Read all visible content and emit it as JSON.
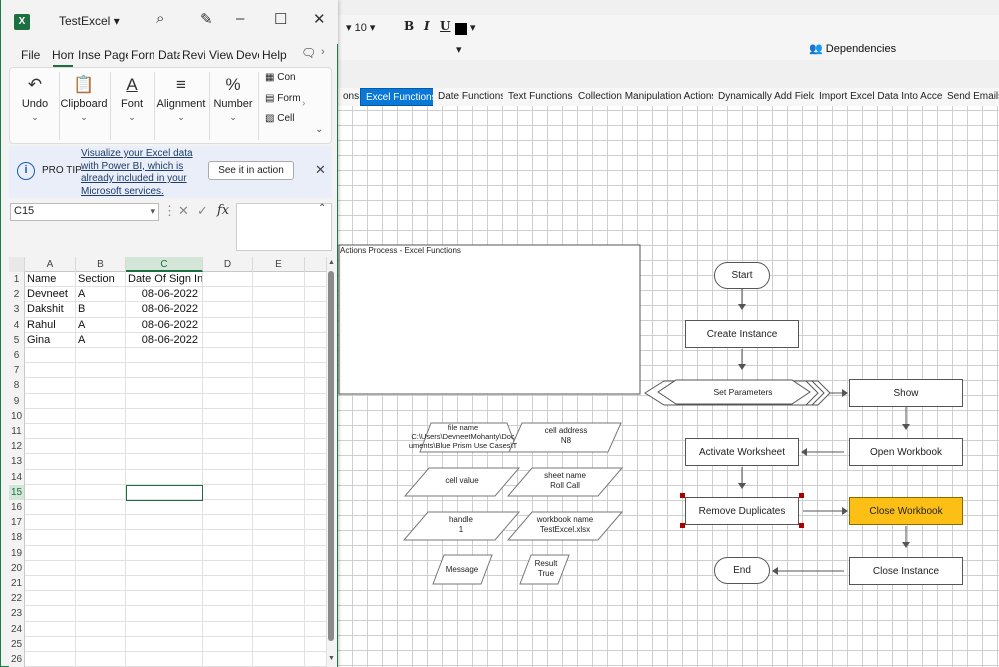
{
  "blueprism": {
    "toolbar": {
      "font_size": "10",
      "bold": "B",
      "italic": "I",
      "underline": "U",
      "dependencies": "Dependencies"
    },
    "tabs": [
      "ons",
      "Excel Functions",
      "Date Functions",
      "Text Functions",
      "Collection Manipulation Actions",
      "Dynamically Add Fields",
      "Import Excel Data Into Access",
      "Send Emails U"
    ],
    "active_tab": "Excel Functions",
    "canvas": {
      "page_title": "Actions Process - Excel Functions",
      "stages": {
        "start": "Start",
        "create_instance": "Create Instance",
        "set_parameters": "Set Parameters",
        "show": "Show",
        "activate_worksheet": "Activate Worksheet",
        "open_workbook": "Open Workbook",
        "remove_duplicates": "Remove Duplicates",
        "close_workbook": "Close Workbook",
        "end": "End",
        "close_instance": "Close Instance"
      },
      "data_items": {
        "file_name": {
          "name": "file name",
          "value1": "C:\\Users\\DevneetMohanty\\Doc",
          "value2": "uments\\Blue Prism Use Cases\\T"
        },
        "cell_address": {
          "name": "cell address",
          "value": "N8"
        },
        "cell_value": {
          "name": "cell value",
          "value": ""
        },
        "sheet_name": {
          "name": "sheet name",
          "value": "Roll Call"
        },
        "handle": {
          "name": "handle",
          "value": "1"
        },
        "workbook_name": {
          "name": "workbook name",
          "value": "TestExcel.xlsx"
        },
        "message": {
          "name": "Message",
          "value": ""
        },
        "result": {
          "name": "Result",
          "value": "True"
        }
      }
    }
  },
  "excel": {
    "title": "TestExcel",
    "logo": "X",
    "menu": [
      "File",
      "Hom",
      "Inser",
      "Page",
      "Form",
      "Data",
      "Revie",
      "View",
      "Deve",
      "Help"
    ],
    "ribbon": {
      "undo": "Undo",
      "clipboard": "Clipboard",
      "font": "Font",
      "alignment": "Alignment",
      "number": "Number",
      "small": [
        "Con",
        "Form",
        "Cell"
      ]
    },
    "protip": {
      "label": "PRO TIP",
      "text": "Visualize your Excel data with Power BI, which is already included in your Microsoft services.",
      "button": "See it in action"
    },
    "namebox": "C15",
    "fx": "fx",
    "columns": [
      "A",
      "B",
      "C",
      "D",
      "E"
    ],
    "selected_col": "C",
    "selected_row": 15,
    "row_numbers": [
      "1",
      "2",
      "3",
      "4",
      "5",
      "6",
      "7",
      "8",
      "9",
      "10",
      "11",
      "12",
      "13",
      "14",
      "15",
      "16",
      "17",
      "18",
      "19",
      "20",
      "21",
      "22",
      "23",
      "24",
      "25",
      "26"
    ],
    "rows": [
      [
        "Name",
        "Section",
        "Date Of Sign In"
      ],
      [
        "Devneet",
        "A",
        "08-06-2022"
      ],
      [
        "Dakshit",
        "B",
        "08-06-2022"
      ],
      [
        "Rahul",
        "A",
        "08-06-2022"
      ],
      [
        "Gina",
        "A",
        "08-06-2022"
      ]
    ]
  }
}
